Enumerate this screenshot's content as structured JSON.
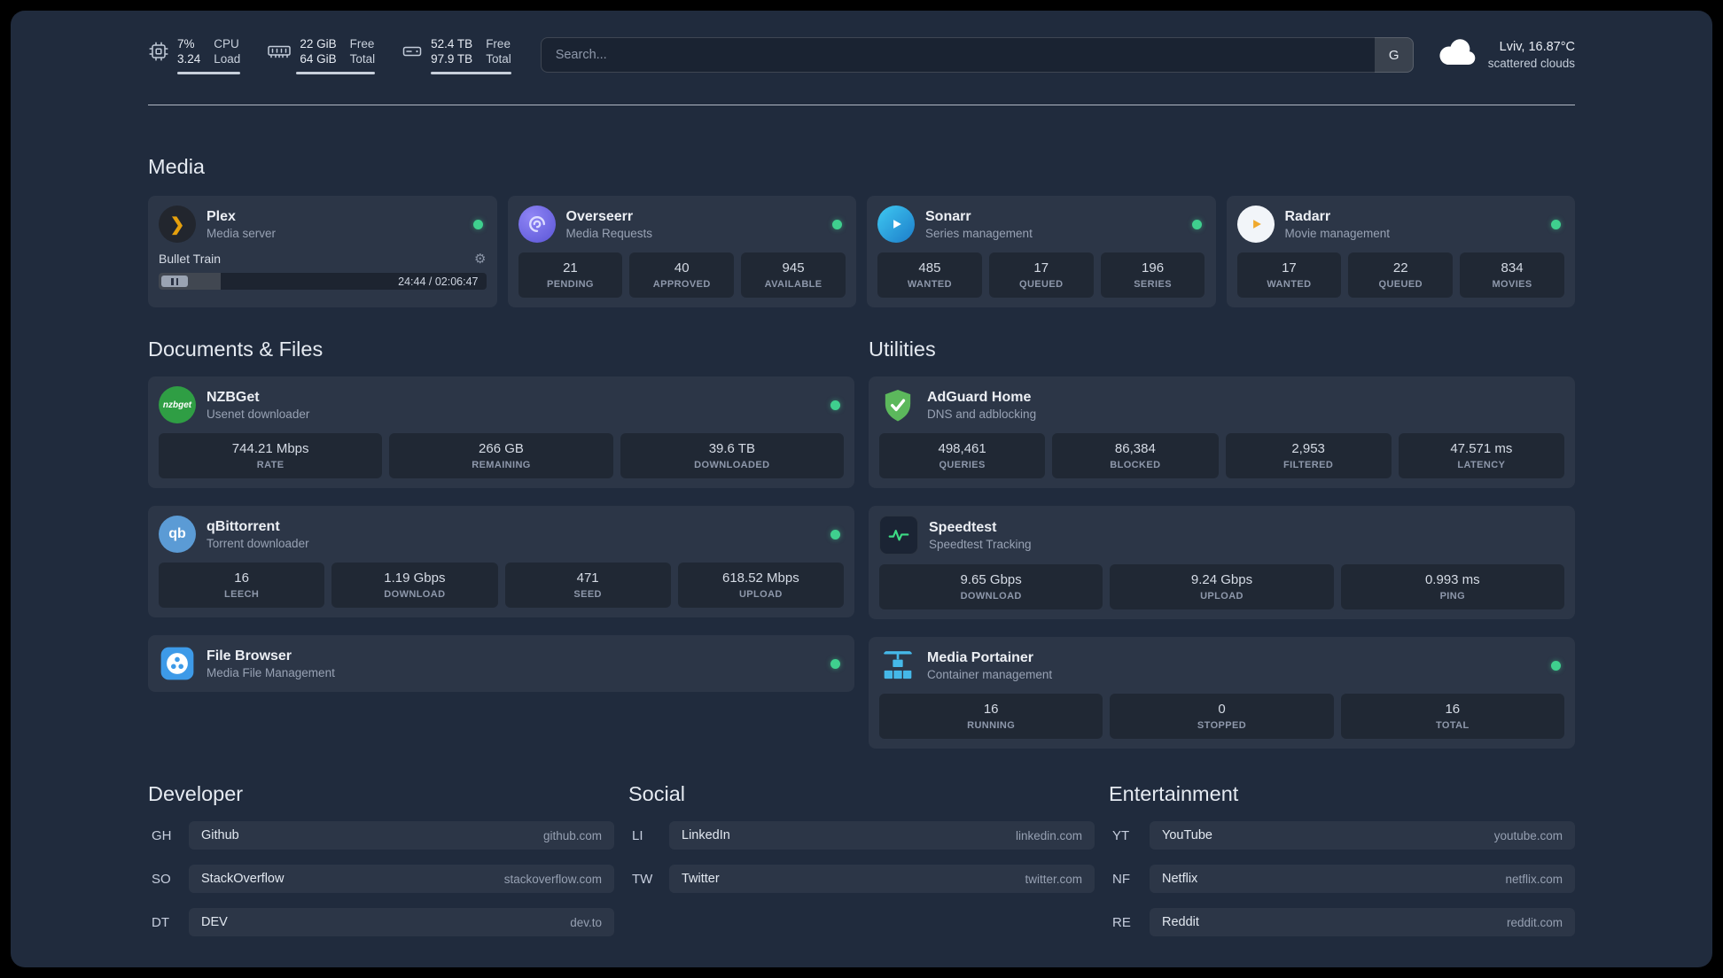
{
  "colors": {
    "status_online": "#3fcf8e",
    "plex_amber": "#e5a00d",
    "overseerr_purple": "#6c5ce7",
    "sonarr_blue": "#2ba8e0",
    "radarr_orange": "#f0a92e",
    "nzbget_green": "#2f9e44",
    "qbittorrent_blue": "#5b9bd5",
    "filebrowser_blue": "#3d9ae8",
    "adguard_green": "#5cb85c",
    "speedtest_green": "#3ddc84",
    "portainer_blue": "#45b8e8"
  },
  "icons": {
    "gear": "⚙",
    "plex_chevron": "❯",
    "nzbget_text": "nzbget",
    "qbittorrent_text": "qb"
  },
  "topbar": {
    "cpu": {
      "value_top": "7%",
      "value_bottom": "3.24",
      "label_top": "CPU",
      "label_bottom": "Load"
    },
    "memory": {
      "value_top": "22 GiB",
      "value_bottom": "64 GiB",
      "label_top": "Free",
      "label_bottom": "Total"
    },
    "disk": {
      "value_top": "52.4 TB",
      "value_bottom": "97.9 TB",
      "label_top": "Free",
      "label_bottom": "Total"
    },
    "search": {
      "placeholder": "Search...",
      "provider": "G"
    },
    "weather": {
      "location": "Lviv, 16.87°C",
      "condition": "scattered clouds"
    }
  },
  "sections": {
    "media": {
      "title": "Media"
    },
    "documents": {
      "title": "Documents & Files"
    },
    "utilities": {
      "title": "Utilities"
    },
    "developer": {
      "title": "Developer"
    },
    "social": {
      "title": "Social"
    },
    "entertainment": {
      "title": "Entertainment"
    }
  },
  "services": {
    "plex": {
      "name": "Plex",
      "desc": "Media server",
      "now_playing": "Bullet Train",
      "time": "24:44 / 02:06:47",
      "progress_percent": 19
    },
    "overseerr": {
      "name": "Overseerr",
      "desc": "Media Requests",
      "stats": [
        {
          "value": "21",
          "label": "PENDING"
        },
        {
          "value": "40",
          "label": "APPROVED"
        },
        {
          "value": "945",
          "label": "AVAILABLE"
        }
      ]
    },
    "sonarr": {
      "name": "Sonarr",
      "desc": "Series management",
      "stats": [
        {
          "value": "485",
          "label": "WANTED"
        },
        {
          "value": "17",
          "label": "QUEUED"
        },
        {
          "value": "196",
          "label": "SERIES"
        }
      ]
    },
    "radarr": {
      "name": "Radarr",
      "desc": "Movie management",
      "stats": [
        {
          "value": "17",
          "label": "WANTED"
        },
        {
          "value": "22",
          "label": "QUEUED"
        },
        {
          "value": "834",
          "label": "MOVIES"
        }
      ]
    },
    "nzbget": {
      "name": "NZBGet",
      "desc": "Usenet downloader",
      "stats": [
        {
          "value": "744.21 Mbps",
          "label": "RATE"
        },
        {
          "value": "266 GB",
          "label": "REMAINING"
        },
        {
          "value": "39.6 TB",
          "label": "DOWNLOADED"
        }
      ]
    },
    "qbittorrent": {
      "name": "qBittorrent",
      "desc": "Torrent downloader",
      "stats": [
        {
          "value": "16",
          "label": "LEECH"
        },
        {
          "value": "1.19 Gbps",
          "label": "DOWNLOAD"
        },
        {
          "value": "471",
          "label": "SEED"
        },
        {
          "value": "618.52 Mbps",
          "label": "UPLOAD"
        }
      ]
    },
    "filebrowser": {
      "name": "File Browser",
      "desc": "Media File Management"
    },
    "adguard": {
      "name": "AdGuard Home",
      "desc": "DNS and adblocking",
      "stats": [
        {
          "value": "498,461",
          "label": "QUERIES"
        },
        {
          "value": "86,384",
          "label": "BLOCKED"
        },
        {
          "value": "2,953",
          "label": "FILTERED"
        },
        {
          "value": "47.571 ms",
          "label": "LATENCY"
        }
      ]
    },
    "speedtest": {
      "name": "Speedtest",
      "desc": "Speedtest Tracking",
      "stats": [
        {
          "value": "9.65 Gbps",
          "label": "DOWNLOAD"
        },
        {
          "value": "9.24 Gbps",
          "label": "UPLOAD"
        },
        {
          "value": "0.993 ms",
          "label": "PING"
        }
      ]
    },
    "portainer": {
      "name": "Media Portainer",
      "desc": "Container management",
      "stats": [
        {
          "value": "16",
          "label": "RUNNING"
        },
        {
          "value": "0",
          "label": "STOPPED"
        },
        {
          "value": "16",
          "label": "TOTAL"
        }
      ]
    }
  },
  "bookmarks": {
    "developer": [
      {
        "abbr": "GH",
        "name": "Github",
        "domain": "github.com"
      },
      {
        "abbr": "SO",
        "name": "StackOverflow",
        "domain": "stackoverflow.com"
      },
      {
        "abbr": "DT",
        "name": "DEV",
        "domain": "dev.to"
      }
    ],
    "social": [
      {
        "abbr": "LI",
        "name": "LinkedIn",
        "domain": "linkedin.com"
      },
      {
        "abbr": "TW",
        "name": "Twitter",
        "domain": "twitter.com"
      }
    ],
    "entertainment": [
      {
        "abbr": "YT",
        "name": "YouTube",
        "domain": "youtube.com"
      },
      {
        "abbr": "NF",
        "name": "Netflix",
        "domain": "netflix.com"
      },
      {
        "abbr": "RE",
        "name": "Reddit",
        "domain": "reddit.com"
      }
    ]
  }
}
